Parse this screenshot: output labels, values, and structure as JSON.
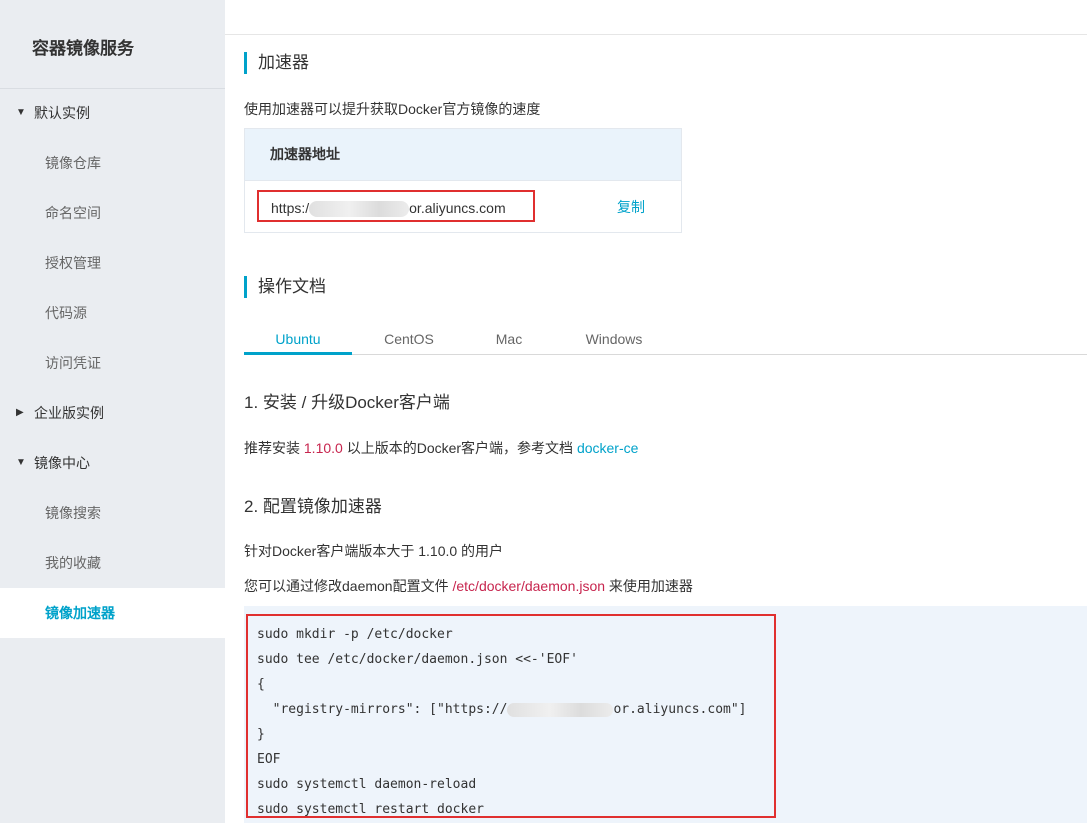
{
  "sidebar": {
    "title": "容器镜像服务",
    "groups": [
      {
        "label": "默认实例",
        "expanded": true,
        "items": [
          {
            "label": "镜像仓库"
          },
          {
            "label": "命名空间"
          },
          {
            "label": "授权管理"
          },
          {
            "label": "代码源"
          },
          {
            "label": "访问凭证"
          }
        ]
      },
      {
        "label": "企业版实例",
        "expanded": false,
        "items": []
      },
      {
        "label": "镜像中心",
        "expanded": true,
        "items": [
          {
            "label": "镜像搜索"
          },
          {
            "label": "我的收藏"
          },
          {
            "label": "镜像加速器",
            "active": true
          }
        ]
      }
    ]
  },
  "accelerator": {
    "title": "加速器",
    "description": "使用加速器可以提升获取Docker官方镜像的速度",
    "table_header": "加速器地址",
    "url_prefix": "https:/",
    "url_suffix": "or.aliyuncs.com",
    "copy_label": "复制"
  },
  "docs": {
    "title": "操作文档",
    "tabs": [
      {
        "label": "Ubuntu",
        "active": true
      },
      {
        "label": "CentOS"
      },
      {
        "label": "Mac"
      },
      {
        "label": "Windows"
      }
    ],
    "step1": {
      "title": "1. 安装 / 升级Docker客户端",
      "text_before": "推荐安装 ",
      "version": "1.10.0",
      "text_middle": " 以上版本的Docker客户端，参考文档 ",
      "link": "docker-ce"
    },
    "step2": {
      "title": "2. 配置镜像加速器",
      "line1": "针对Docker客户端版本大于 1.10.0 的用户",
      "line2_before": "您可以通过修改daemon配置文件 ",
      "config_path": "/etc/docker/daemon.json",
      "line2_after": " 来使用加速器"
    },
    "code": {
      "line1": "sudo mkdir -p /etc/docker",
      "line2": "sudo tee /etc/docker/daemon.json <<-'EOF'",
      "line3": "{",
      "line4_prefix": "  \"registry-mirrors\": [\"https://",
      "line4_suffix": "or.aliyuncs.com\"]",
      "line5": "}",
      "line6": "EOF",
      "line7": "sudo systemctl daemon-reload",
      "line8": "sudo systemctl restart docker"
    }
  },
  "colors": {
    "accent": "#00a2ca",
    "highlight_border": "#e02f2f",
    "brand": "#ff6a00",
    "sidebar_bg": "#eaedf1"
  }
}
